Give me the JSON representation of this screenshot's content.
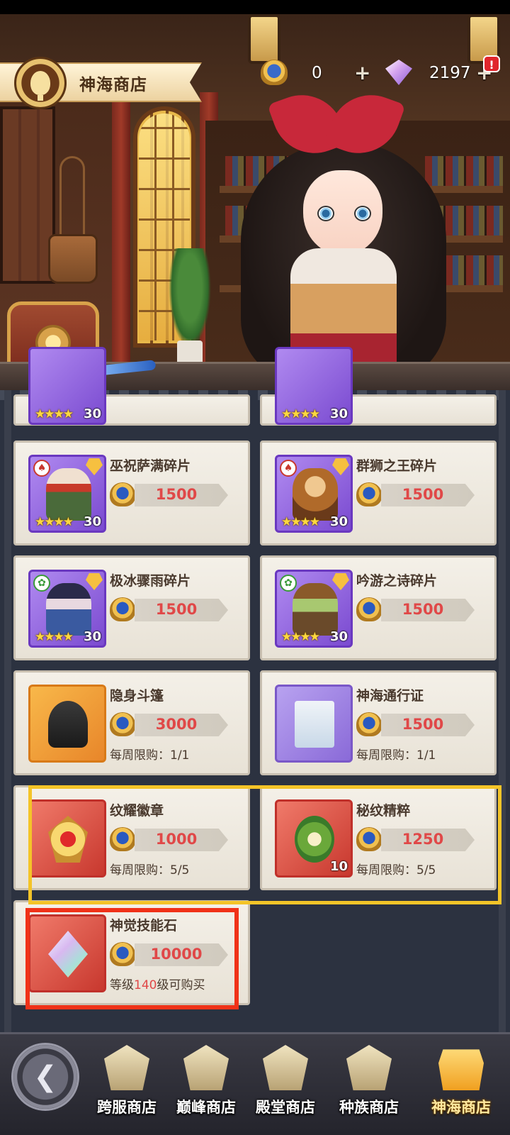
{
  "header": {
    "shop_title": "神海商店",
    "shop_icon": "hot-air-balloon-icon",
    "currencies": [
      {
        "name": "神海币",
        "icon": "shield-coin-icon",
        "value": "0",
        "plus": "+"
      },
      {
        "name": "钻石",
        "icon": "diamond-icon",
        "value": "2197",
        "plus": "+"
      }
    ],
    "alert": "!"
  },
  "items": [
    {
      "name": "巫祝萨满碎片",
      "price": "1500",
      "stars": "★★★★",
      "count": "30",
      "class_icon": "♠"
    },
    {
      "name": "群狮之王碎片",
      "price": "1500",
      "stars": "★★★★",
      "count": "30",
      "class_icon": "♠"
    },
    {
      "name": "极冰骤雨碎片",
      "price": "1500",
      "stars": "★★★★",
      "count": "30",
      "class_icon": "✿"
    },
    {
      "name": "吟游之诗碎片",
      "price": "1500",
      "stars": "★★★★",
      "count": "30",
      "class_icon": "✿"
    },
    {
      "name": "隐身斗篷",
      "price": "3000",
      "limit": "每周限购：1/1"
    },
    {
      "name": "神海通行证",
      "price": "1500",
      "limit": "每周限购：1/1"
    },
    {
      "name": "纹耀徽章",
      "price": "1000",
      "limit": "每周限购：5/5"
    },
    {
      "name": "秘纹精粹",
      "price": "1250",
      "limit": "每周限购：5/5",
      "count": "10"
    },
    {
      "name": "神觉技能石",
      "price": "10000",
      "limit_pre": "等级",
      "limit_level": "140",
      "limit_post": "级可购买"
    }
  ],
  "partial_row": {
    "stars": "★★★★",
    "count": "30"
  },
  "nav": {
    "back_icon": "back-arrow-icon",
    "tabs": [
      {
        "label": "跨服商店",
        "active": false
      },
      {
        "label": "巅峰商店",
        "active": false
      },
      {
        "label": "殿堂商店",
        "active": false
      },
      {
        "label": "种族商店",
        "active": false
      },
      {
        "label": "神海商店",
        "active": true
      }
    ]
  },
  "colors": {
    "price": "#e04848",
    "highlight_yellow": "#f4c428",
    "highlight_red": "#f03218",
    "active_tab": "#ffe9a0"
  }
}
